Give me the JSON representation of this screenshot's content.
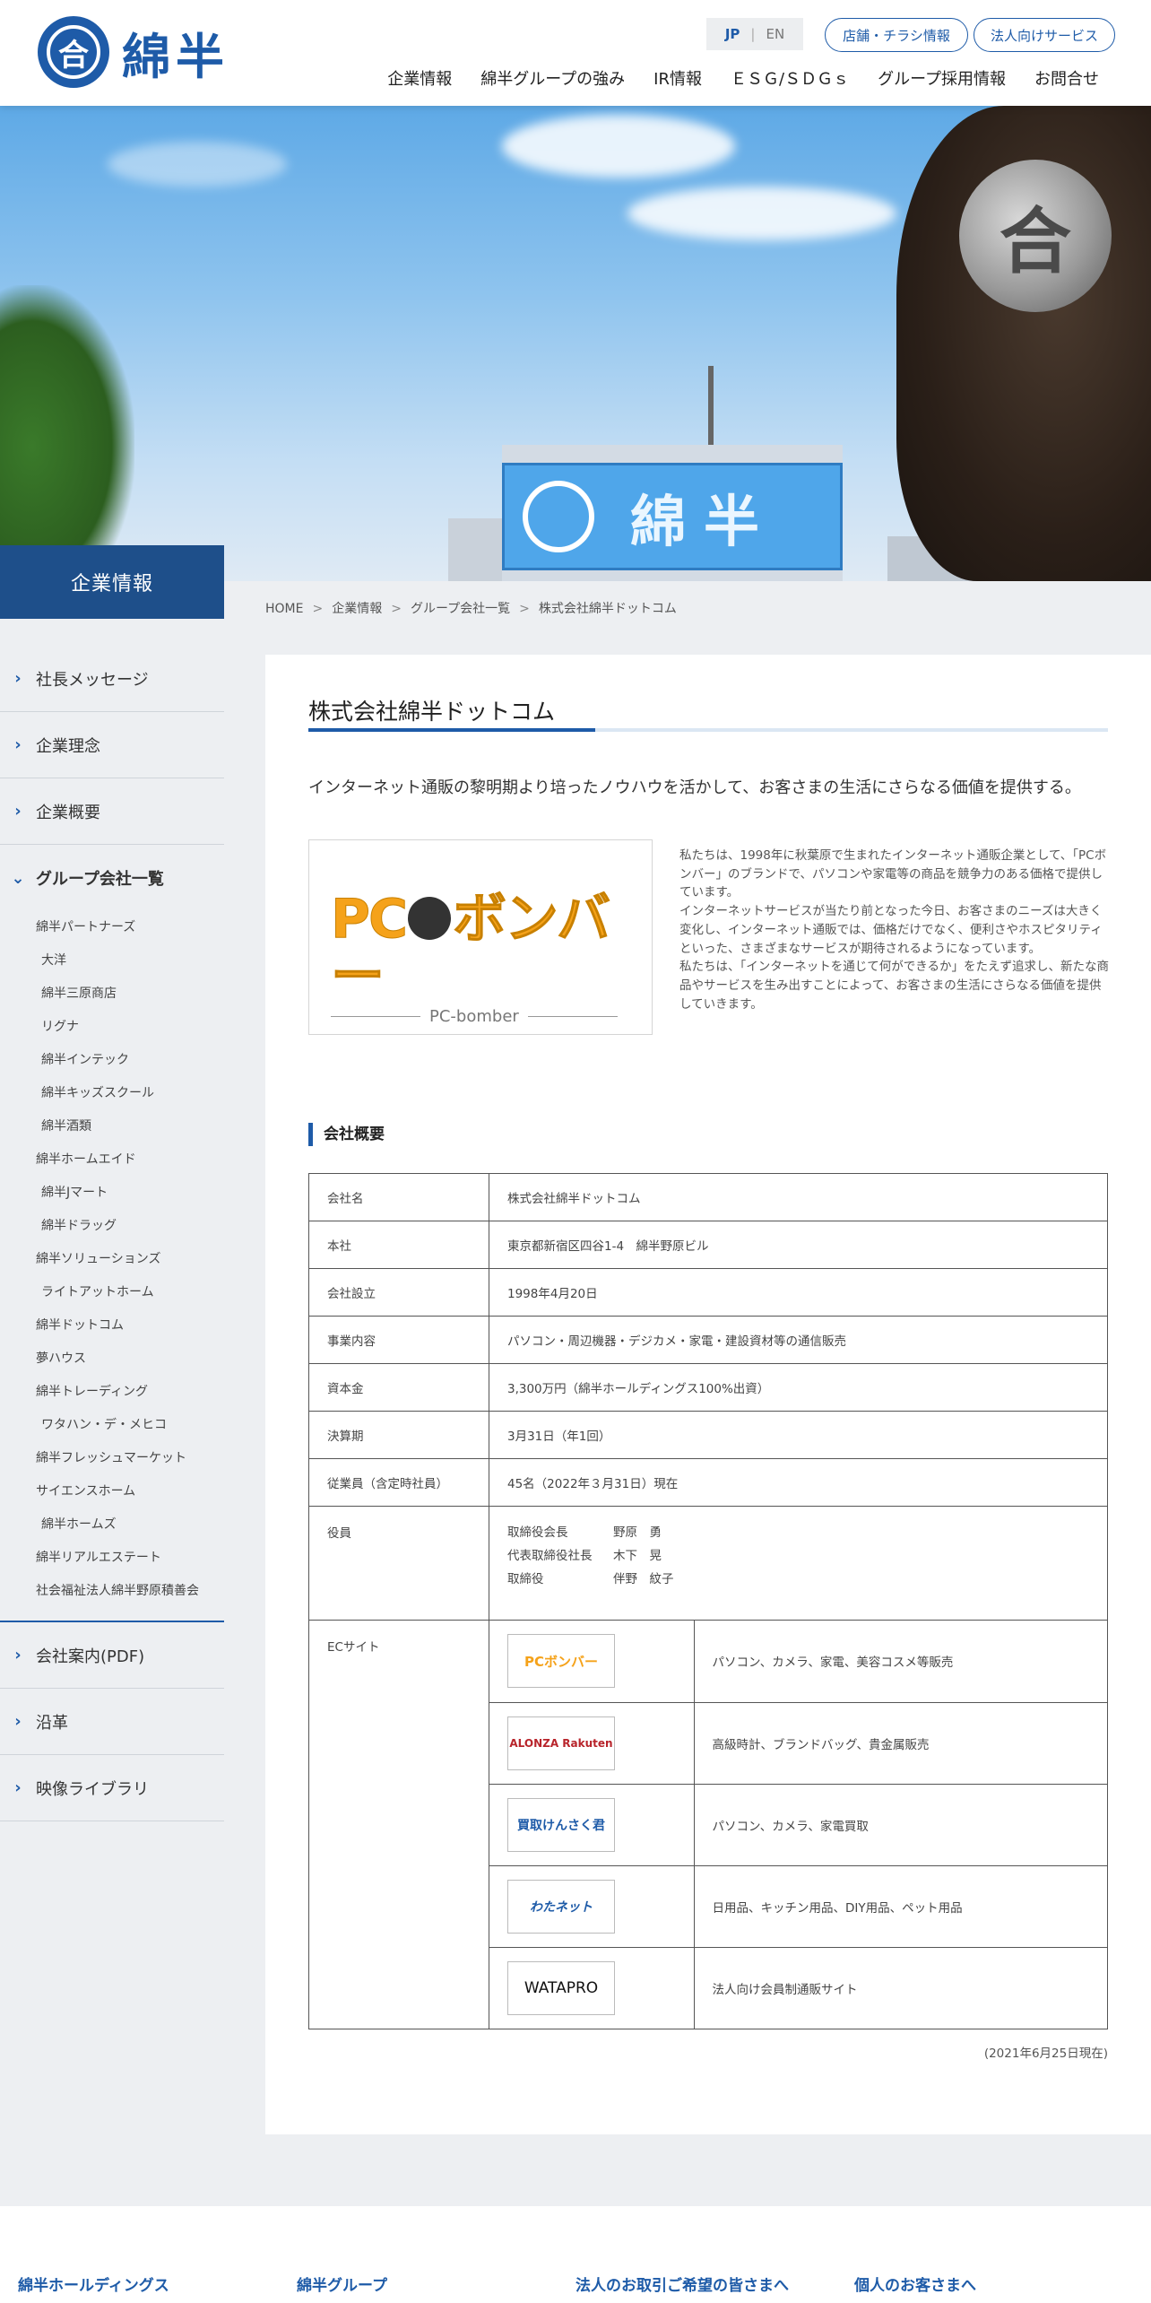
{
  "header": {
    "logo_mark": "合",
    "logo_text": "綿半",
    "lang_jp": "JP",
    "lang_sep": "|",
    "lang_en": "EN",
    "pill_store": "店舗・チラシ情報",
    "pill_business": "法人向けサービス",
    "nav": [
      "企業情報",
      "綿半グループの強み",
      "IR情報",
      "ＥＳＧ/ＳＤＧｓ",
      "グループ採用情報",
      "お問合せ"
    ]
  },
  "hero": {
    "sign_text": "綿半",
    "rock_glyph": "合"
  },
  "sidebar": {
    "title": "企業情報",
    "items_top": [
      "社長メッセージ",
      "企業理念",
      "企業概要"
    ],
    "active": "グループ会社一覧",
    "sub_items": [
      {
        "label": "綿半パートナーズ",
        "child": false
      },
      {
        "label": "大洋",
        "child": true
      },
      {
        "label": "綿半三原商店",
        "child": true
      },
      {
        "label": "リグナ",
        "child": true
      },
      {
        "label": "綿半インテック",
        "child": true
      },
      {
        "label": "綿半キッズスクール",
        "child": true
      },
      {
        "label": "綿半酒類",
        "child": true
      },
      {
        "label": "綿半ホームエイド",
        "child": false
      },
      {
        "label": "綿半Jマート",
        "child": true
      },
      {
        "label": "綿半ドラッグ",
        "child": true
      },
      {
        "label": "綿半ソリューションズ",
        "child": false
      },
      {
        "label": "ライトアットホーム",
        "child": true
      },
      {
        "label": "綿半ドットコム",
        "child": false
      },
      {
        "label": "夢ハウス",
        "child": false
      },
      {
        "label": "綿半トレーディング",
        "child": false
      },
      {
        "label": "ワタハン・デ・メヒコ",
        "child": true
      },
      {
        "label": "綿半フレッシュマーケット",
        "child": false
      },
      {
        "label": "サイエンスホーム",
        "child": false
      },
      {
        "label": "綿半ホームズ",
        "child": true
      },
      {
        "label": "綿半リアルエステート",
        "child": false
      },
      {
        "label": "社会福祉法人綿半野原積善会",
        "child": false
      }
    ],
    "items_bottom": [
      "会社案内(PDF)",
      "沿革",
      "映像ライブラリ"
    ],
    "chevron": "›",
    "chevron_open": "⌄"
  },
  "breadcrumb": [
    "HOME",
    "企業情報",
    "グループ会社一覧",
    "株式会社綿半ドットコム"
  ],
  "breadcrumb_sep": ">",
  "main": {
    "title": "株式会社綿半ドットコム",
    "lead": "インターネット通販の黎明期より培ったノウハウを活かして、お客さまの生活にさらなる価値を提供する。",
    "logo_main_a": "PC",
    "logo_main_b": "ボンバー",
    "logo_sub": "PC-bomber",
    "about": "私たちは、1998年に秋葉原で生まれたインターネット通販企業として、「PCボンバー」のブランドで、パソコンや家電等の商品を競争力のある価格で提供しています。\nインターネットサービスが当たり前となった今日、お客さまのニーズは大きく変化し、インターネット通販では、価格だけでなく、便利さやホスピタリティといった、さまざまなサービスが期待されるようになっています。\n私たちは、「インターネットを通じて何ができるか」をたえず追求し、新たな商品やサービスを生み出すことによって、お客さまの生活にさらなる価値を提供していきます。",
    "section_title": "会社概要",
    "rows": [
      {
        "label": "会社名",
        "value": "株式会社綿半ドットコム"
      },
      {
        "label": "本社",
        "value": "東京都新宿区四谷1-4　綿半野原ビル"
      },
      {
        "label": "会社設立",
        "value": "1998年4月20日"
      },
      {
        "label": "事業内容",
        "value": "パソコン・周辺機器・デジカメ・家電・建設資材等の通信販売"
      },
      {
        "label": "資本金",
        "value": "3,300万円（綿半ホールディングス100%出資）"
      },
      {
        "label": "決算期",
        "value": "3月31日（年1回）"
      },
      {
        "label": "従業員（含定時社員）",
        "value": "45名（2022年３月31日）現在"
      }
    ],
    "officers_label": "役員",
    "officers": [
      {
        "role": "取締役会長",
        "name": "野原　勇"
      },
      {
        "role": "代表取締役社長",
        "name": "木下　晃"
      },
      {
        "role": "取締役",
        "name": "伴野　紋子"
      }
    ],
    "ec_label": "ECサイト",
    "ec_sites": [
      {
        "logo": "PCボンバー",
        "desc": "パソコン、カメラ、家電、美容コスメ等販売"
      },
      {
        "logo": "ALONZA Rakuten",
        "desc": "高級時計、ブランドバッグ、貴金属販売"
      },
      {
        "logo": "買取けんさく君",
        "desc": "パソコン、カメラ、家電買取"
      },
      {
        "logo": "わたネット",
        "desc": "日用品、キッチン用品、DIY用品、ペット用品"
      },
      {
        "logo": "WATAPRO",
        "desc": "法人向け会員制通販サイト"
      }
    ],
    "note": "(2021年6月25日現在)"
  },
  "footer": {
    "cols": [
      "綿半ホールディングス",
      "綿半グループ",
      "法人のお取引ご希望の皆さまへ",
      "個人のお客さまへ"
    ]
  },
  "colors": {
    "brand": "#1e5ba8",
    "sidebar_title_bg": "#1e4f8a",
    "page_bg": "#edeff2",
    "logo_orange": "#f5a21a"
  }
}
